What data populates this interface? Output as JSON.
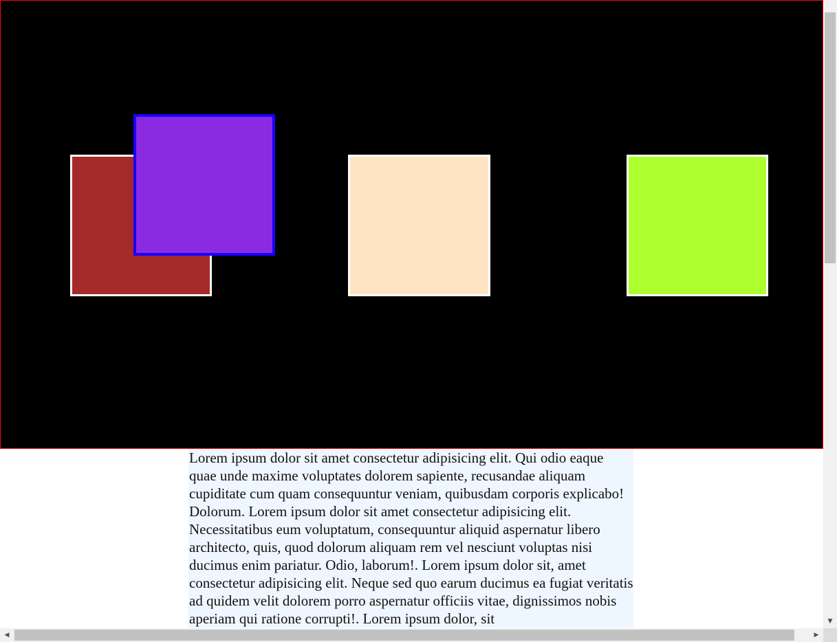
{
  "stage": {
    "background": "#000000",
    "border_color": "#ff0000",
    "boxes": [
      {
        "name": "brown",
        "fill": "#a52a2a",
        "border": "#ffffff"
      },
      {
        "name": "purple",
        "fill": "#8a2be2",
        "border": "#1a00ff"
      },
      {
        "name": "peach",
        "fill": "#ffe4c4",
        "border": "#ffffff"
      },
      {
        "name": "lime",
        "fill": "#adff2f",
        "border": "#ffffff"
      }
    ]
  },
  "article": {
    "text": "Lorem ipsum dolor sit amet consectetur adipisicing elit. Qui odio eaque quae unde maxime voluptates dolorem sapiente, recusandae aliquam cupiditate cum quam consequuntur veniam, quibusdam corporis explicabo! Dolorum. Lorem ipsum dolor sit amet consectetur adipisicing elit. Necessitatibus eum voluptatum, consequuntur aliquid aspernatur libero architecto, quis, quod dolorum aliquam rem vel nesciunt voluptas nisi ducimus enim pariatur. Odio, laborum!. Lorem ipsum dolor sit, amet consectetur adipisicing elit. Neque sed quo earum ducimus ea fugiat veritatis ad quidem velit dolorem porro aspernatur officiis vitae, dignissimos nobis aperiam qui ratione corrupti!. Lorem ipsum dolor, sit",
    "background": "#eef6ff"
  },
  "scrollbars": {
    "arrow_up_icon": "triangle-up",
    "arrow_down_icon": "triangle-down",
    "arrow_left_icon": "triangle-left",
    "arrow_right_icon": "triangle-right",
    "down_glyph": "▼",
    "left_glyph": "◀",
    "right_glyph": "▶"
  }
}
